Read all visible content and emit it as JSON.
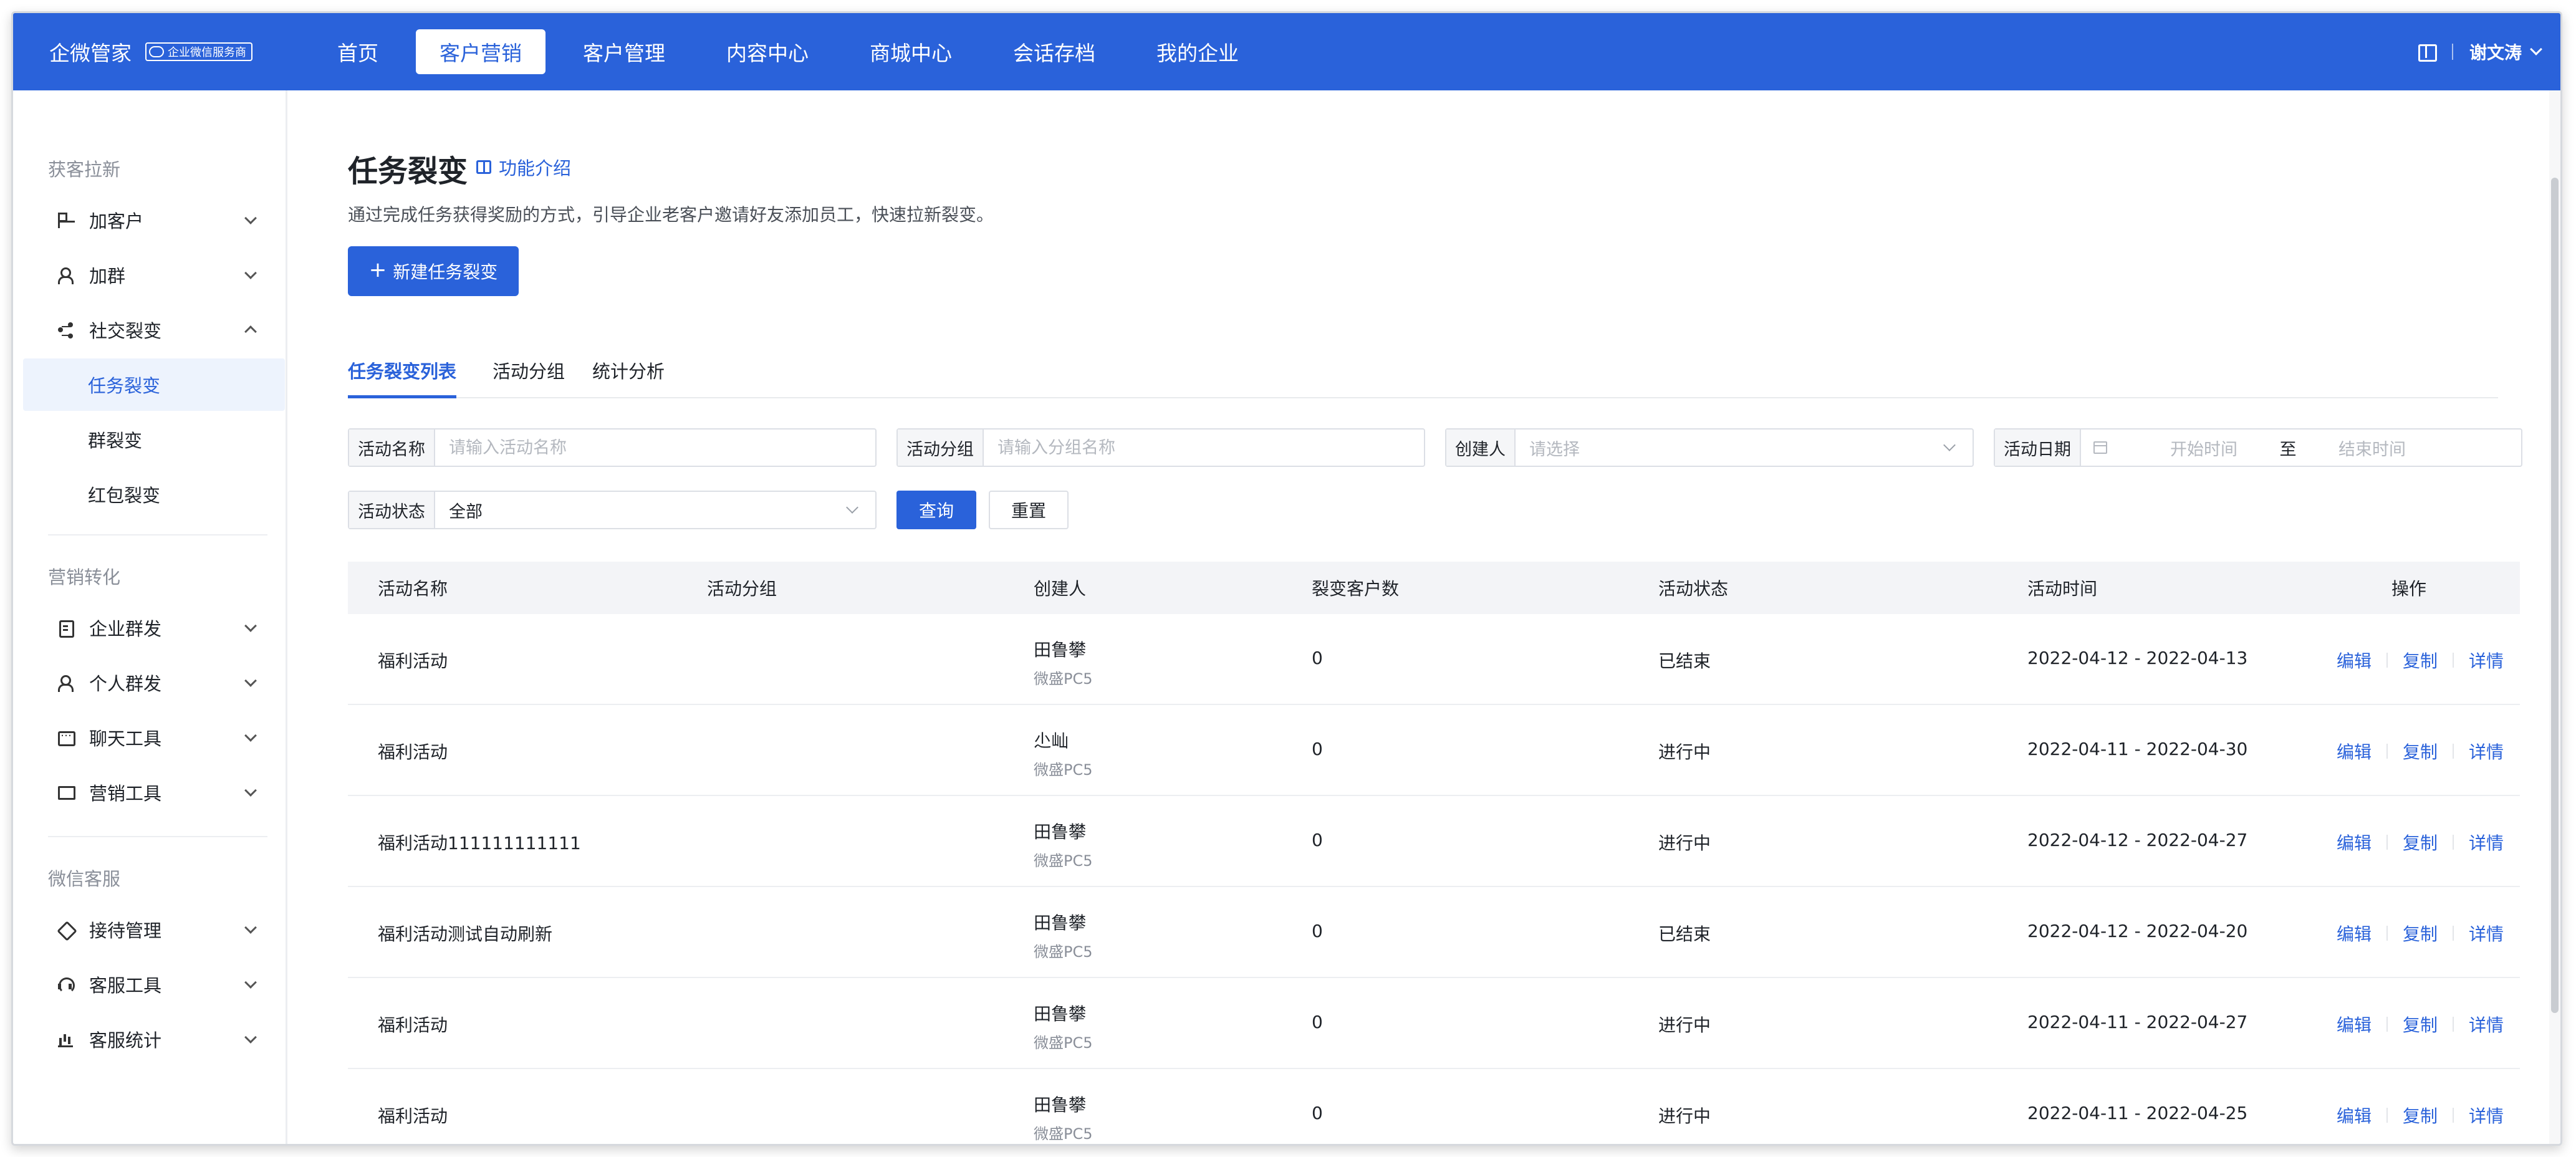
{
  "app": {
    "brand": "企微管家",
    "badge": "企业微信服务商"
  },
  "nav": {
    "items": [
      "首页",
      "客户营销",
      "客户管理",
      "内容中心",
      "商城中心",
      "会话存档",
      "我的企业"
    ],
    "active_index": 1
  },
  "user": {
    "name": "谢文涛"
  },
  "sidebar": {
    "sections": [
      "获客拉新",
      "营销转化",
      "微信客服"
    ],
    "groups": [
      {
        "label": "加客户",
        "icon": "grid-icon"
      },
      {
        "label": "加群",
        "icon": "person-icon"
      },
      {
        "label": "社交裂变",
        "icon": "share-icon",
        "expanded": true
      },
      {
        "label": "任务裂变",
        "sub": true,
        "active": true
      },
      {
        "label": "群裂变",
        "sub": true
      },
      {
        "label": "红包裂变",
        "sub": true
      },
      {
        "label": "企业群发",
        "icon": "doc-icon"
      },
      {
        "label": "个人群发",
        "icon": "person-icon"
      },
      {
        "label": "聊天工具",
        "icon": "chat-icon"
      },
      {
        "label": "营销工具",
        "icon": "monitor-icon"
      },
      {
        "label": "接待管理",
        "icon": "tag-icon"
      },
      {
        "label": "客服工具",
        "icon": "headset-icon"
      },
      {
        "label": "客服统计",
        "icon": "bars-icon"
      }
    ]
  },
  "page": {
    "title": "任务裂变",
    "intro_link": "功能介绍",
    "description": "通过完成任务获得奖励的方式，引导企业老客户邀请好友添加员工，快速拉新裂变。",
    "new_button": "新建任务裂变"
  },
  "tabs": [
    "任务裂变列表",
    "活动分组",
    "统计分析"
  ],
  "filters": {
    "name": {
      "label": "活动名称",
      "placeholder": "请输入活动名称"
    },
    "group": {
      "label": "活动分组",
      "placeholder": "请输入分组名称"
    },
    "creator": {
      "label": "创建人",
      "placeholder": "请选择"
    },
    "date": {
      "label": "活动日期",
      "start": "开始时间",
      "sep": "至",
      "end": "结束时间"
    },
    "status": {
      "label": "活动状态",
      "value": "全部"
    },
    "query_button": "查询",
    "reset_button": "重置"
  },
  "table": {
    "columns": [
      "活动名称",
      "活动分组",
      "创建人",
      "裂变客户数",
      "活动状态",
      "活动时间",
      "操作"
    ],
    "rows": [
      {
        "name": "福利活动",
        "group": "",
        "creator": "田鲁攀",
        "org": "微盛PC5",
        "count": "0",
        "status": "已结束",
        "time": "2022-04-12 - 2022-04-13"
      },
      {
        "name": "福利活动",
        "group": "",
        "creator": "尐屾",
        "org": "微盛PC5",
        "count": "0",
        "status": "进行中",
        "time": "2022-04-11 - 2022-04-30"
      },
      {
        "name": "福利活动111111111111",
        "group": "",
        "creator": "田鲁攀",
        "org": "微盛PC5",
        "count": "0",
        "status": "进行中",
        "time": "2022-04-12 - 2022-04-27"
      },
      {
        "name": "福利活动测试自动刷新",
        "group": "",
        "creator": "田鲁攀",
        "org": "微盛PC5",
        "count": "0",
        "status": "已结束",
        "time": "2022-04-12 - 2022-04-20"
      },
      {
        "name": "福利活动",
        "group": "",
        "creator": "田鲁攀",
        "org": "微盛PC5",
        "count": "0",
        "status": "进行中",
        "time": "2022-04-11 - 2022-04-27"
      },
      {
        "name": "福利活动",
        "group": "",
        "creator": "田鲁攀",
        "org": "微盛PC5",
        "count": "0",
        "status": "进行中",
        "time": "2022-04-11 - 2022-04-25"
      }
    ],
    "actions": [
      "编辑",
      "复制",
      "详情"
    ]
  },
  "colors": {
    "primary": "#2a62da",
    "sidebar_active_bg": "#edf3fd"
  }
}
